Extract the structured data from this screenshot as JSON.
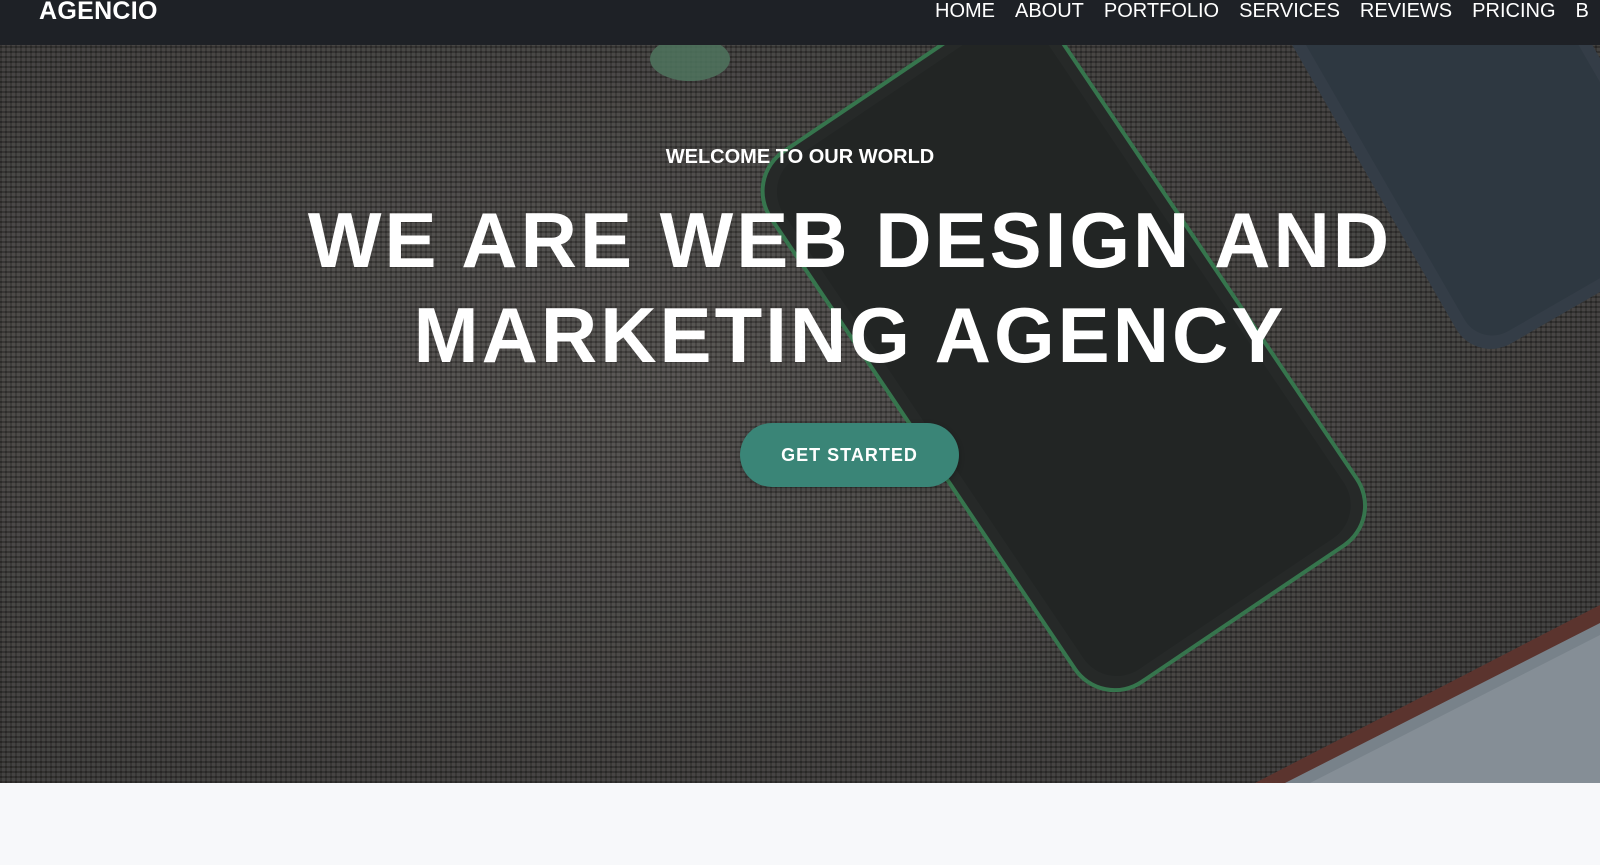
{
  "navbar": {
    "brand": "AGENCIO",
    "links": [
      "HOME",
      "ABOUT",
      "PORTFOLIO",
      "SERVICES",
      "REVIEWS",
      "PRICING",
      "B"
    ]
  },
  "hero": {
    "eyebrow": "WELCOME TO OUR WORLD",
    "title_line1": "WE ARE WEB DESIGN AND",
    "title_line2": "MARKETING AGENCY",
    "cta_label": "GET STARTED"
  },
  "colors": {
    "navbar_bg": "#1e2126",
    "cta_bg": "#3a8577",
    "phone_accent": "#3d8a5a",
    "page_bg": "#f7f8fa"
  }
}
